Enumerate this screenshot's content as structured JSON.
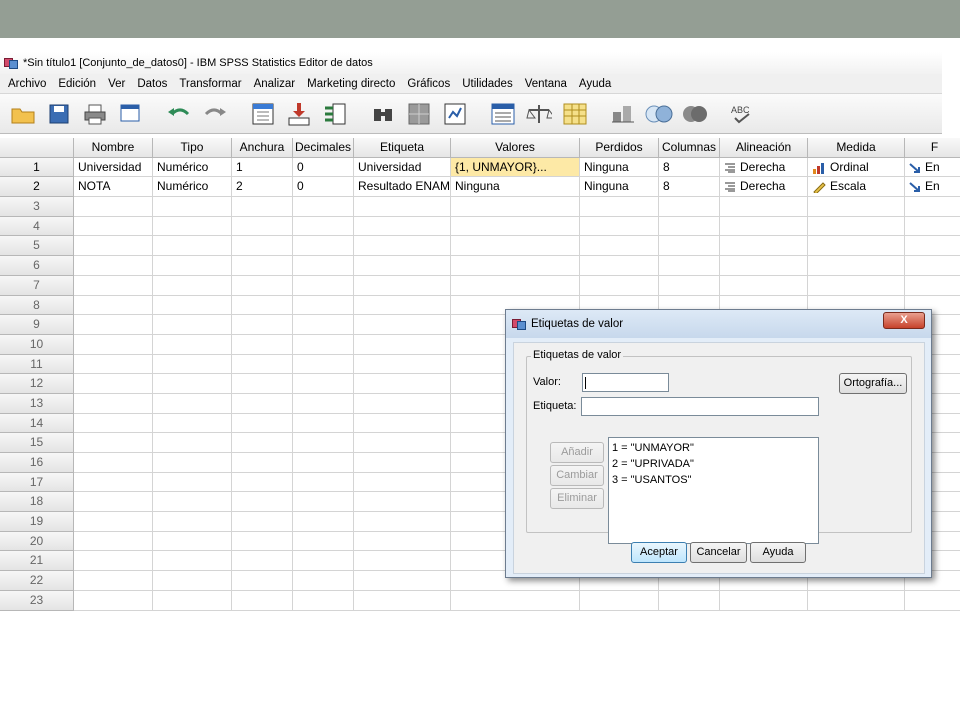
{
  "window": {
    "title": "*Sin título1 [Conjunto_de_datos0] - IBM SPSS Statistics Editor de datos"
  },
  "menu": [
    "Archivo",
    "Edición",
    "Ver",
    "Datos",
    "Transformar",
    "Analizar",
    "Marketing directo",
    "Gráficos",
    "Utilidades",
    "Ventana",
    "Ayuda"
  ],
  "toolbar_icons": [
    "open-folder-icon",
    "save-icon",
    "print-icon",
    "recall-dialog-icon",
    "undo-icon",
    "redo-icon",
    "goto-case-icon",
    "goto-variable-icon",
    "variables-icon",
    "find-icon",
    "split-file-icon",
    "weight-cases-icon",
    "select-cases-icon",
    "value-labels-icon",
    "use-sets-icon",
    "show-all-variables-icon",
    "spell-check-icon"
  ],
  "grid": {
    "headers": [
      "Nombre",
      "Tipo",
      "Anchura",
      "Decimales",
      "Etiqueta",
      "Valores",
      "Perdidos",
      "Columnas",
      "Alineación",
      "Medida",
      "F"
    ],
    "rows": [
      {
        "num": "1",
        "cells": [
          "Universidad",
          "Numérico",
          "1",
          "0",
          "Universidad",
          "{1, UNMAYOR}...",
          "Ninguna",
          "8",
          "Derecha",
          "Ordinal",
          "En"
        ]
      },
      {
        "num": "2",
        "cells": [
          "NOTA",
          "Numérico",
          "2",
          "0",
          "Resultado ENAM",
          "Ninguna",
          "Ninguna",
          "8",
          "Derecha",
          "Escala",
          "En"
        ]
      }
    ],
    "empty_rows": [
      "3",
      "4",
      "5",
      "6",
      "7",
      "8",
      "9",
      "10",
      "11",
      "12",
      "13",
      "14",
      "15",
      "16",
      "17",
      "18",
      "19",
      "20",
      "21",
      "22",
      "23"
    ]
  },
  "dialog": {
    "title": "Etiquetas de valor",
    "close": "X",
    "group_label": "Etiquetas de valor",
    "valor_label": "Valor:",
    "valor_value": "",
    "etiqueta_label": "Etiqueta:",
    "etiqueta_value": "",
    "spelling": "Ortografía...",
    "add": "Añadir",
    "change": "Cambiar",
    "remove": "Eliminar",
    "labels": [
      "1 = \"UNMAYOR\"",
      "2 = \"UPRIVADA\"",
      "3 = \"USANTOS\""
    ],
    "ok": "Aceptar",
    "cancel": "Cancelar",
    "help": "Ayuda"
  }
}
